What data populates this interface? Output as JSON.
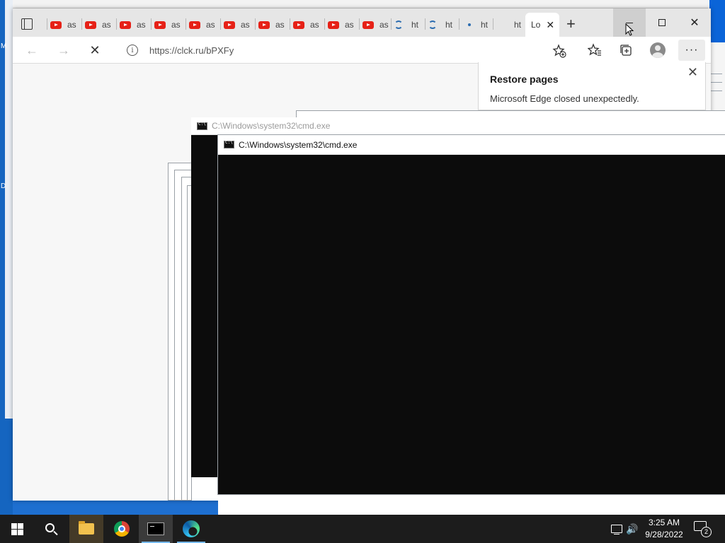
{
  "desktop": {
    "left_letters": [
      "M",
      "D"
    ]
  },
  "edge": {
    "tabs": [
      {
        "kind": "youtube",
        "label": "as"
      },
      {
        "kind": "youtube",
        "label": "as"
      },
      {
        "kind": "youtube",
        "label": "as"
      },
      {
        "kind": "youtube",
        "label": "as"
      },
      {
        "kind": "youtube",
        "label": "as"
      },
      {
        "kind": "youtube",
        "label": "as"
      },
      {
        "kind": "youtube",
        "label": "as"
      },
      {
        "kind": "youtube",
        "label": "as"
      },
      {
        "kind": "youtube",
        "label": "as"
      },
      {
        "kind": "youtube",
        "label": "as"
      },
      {
        "kind": "loading",
        "label": "ht"
      },
      {
        "kind": "loading",
        "label": "ht"
      },
      {
        "kind": "dot",
        "label": "ht"
      },
      {
        "kind": "blank",
        "label": "ht"
      }
    ],
    "active_tab": {
      "label": "Lo",
      "close": "✕"
    },
    "new_tab": "+",
    "window_close": "✕",
    "toolbar": {
      "back": "←",
      "forward": "→",
      "stop": "✕",
      "url": "https://clck.ru/bPXFy",
      "more": "···"
    },
    "restore_popup": {
      "title": "Restore pages",
      "message": "Microsoft Edge closed unexpectedly.",
      "close": "✕"
    }
  },
  "cmd_windows": [
    {
      "title": "C:\\Windows\\system32\\cmd.exe",
      "inactive": true
    },
    {
      "title": "C:\\Windows\\system32\\cmd.exe",
      "inactive": false
    }
  ],
  "taskbar": {
    "items": [
      "start-button",
      "search",
      "file-explorer",
      "chrome",
      "cmd",
      "edge"
    ],
    "clock": {
      "time": "3:25 AM",
      "date": "9/28/2022"
    },
    "notification_count": "2",
    "volume_glyph": "🔊"
  }
}
